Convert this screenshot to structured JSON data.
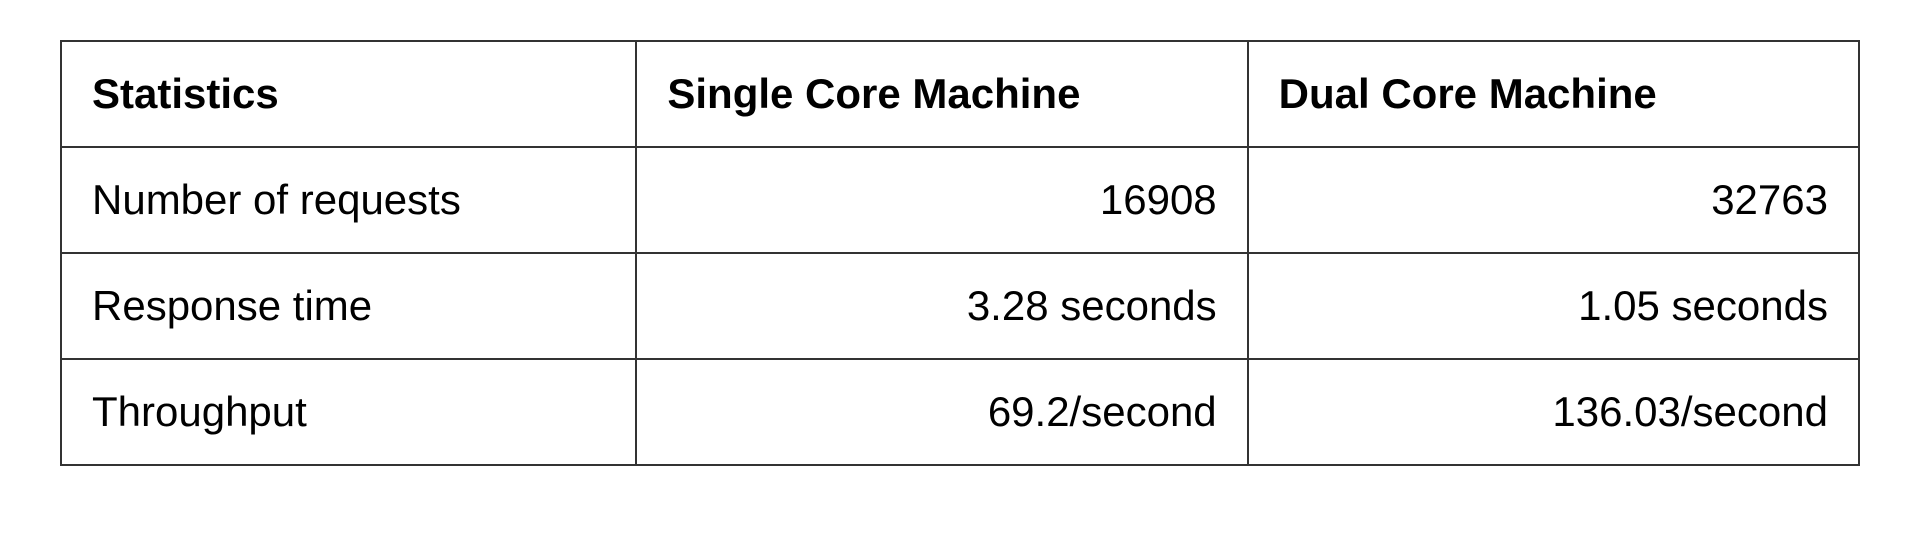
{
  "chart_data": {
    "type": "table",
    "headers": [
      "Statistics",
      "Single Core Machine",
      "Dual Core Machine"
    ],
    "rows": [
      {
        "label": "Number of requests",
        "single": "16908",
        "dual": "32763"
      },
      {
        "label": "Response time",
        "single": "3.28 seconds",
        "dual": "1.05 seconds"
      },
      {
        "label": "Throughput",
        "single": "69.2/second",
        "dual": "136.03/second"
      }
    ]
  }
}
